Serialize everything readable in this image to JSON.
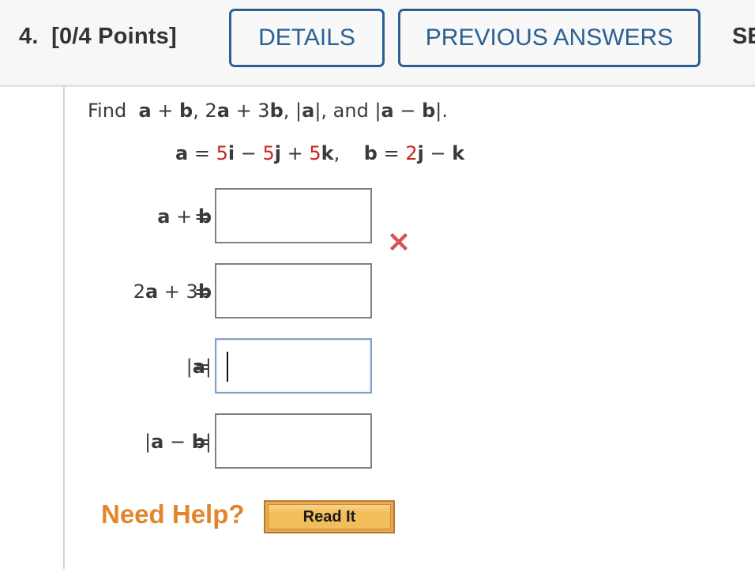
{
  "header": {
    "question_number": "4.",
    "points": "[0/4 Points]",
    "details_button": "DETAILS",
    "previous_answers_button": "PREVIOUS ANSWERS",
    "cut_off_button": "SE"
  },
  "question": {
    "prompt": {
      "find": "Find",
      "parts": [
        "a",
        " + ",
        "b",
        ", 2",
        "a",
        " + 3",
        "b",
        ", |",
        "a",
        "|, and |",
        "a",
        " − ",
        "b",
        "|."
      ]
    },
    "vectors": {
      "a_name": "a",
      "eq1": " = ",
      "a_c1": "5",
      "a_u1": "i",
      "a_op1": " − ",
      "a_c2": "5",
      "a_u2": "j",
      "a_op2": " + ",
      "a_c3": "5",
      "a_u3": "k",
      "sep": ",    ",
      "b_name": "b",
      "eq2": " = ",
      "b_c1": "2",
      "b_u1": "j",
      "b_op1": " − ",
      "b_u2": "k"
    },
    "colors": {
      "coefficient": "#c5261e",
      "accent": "#2b6093",
      "help": "#e2862e"
    }
  },
  "answers": [
    {
      "label_parts": [
        "a",
        " + ",
        "b"
      ],
      "eq": "=",
      "value": "",
      "status": "incorrect",
      "focused": false
    },
    {
      "label_parts": [
        "2",
        "a",
        " + 3",
        "b"
      ],
      "eq": "=",
      "value": "",
      "status": "",
      "focused": false
    },
    {
      "label_parts": [
        "|",
        "a",
        "|"
      ],
      "eq": "=",
      "value": "",
      "status": "",
      "focused": true
    },
    {
      "label_parts": [
        "|",
        "a",
        " − ",
        "b",
        "|"
      ],
      "eq": "=",
      "value": "",
      "status": "",
      "focused": false
    }
  ],
  "help": {
    "label": "Need Help?",
    "read_it_button": "Read It"
  }
}
